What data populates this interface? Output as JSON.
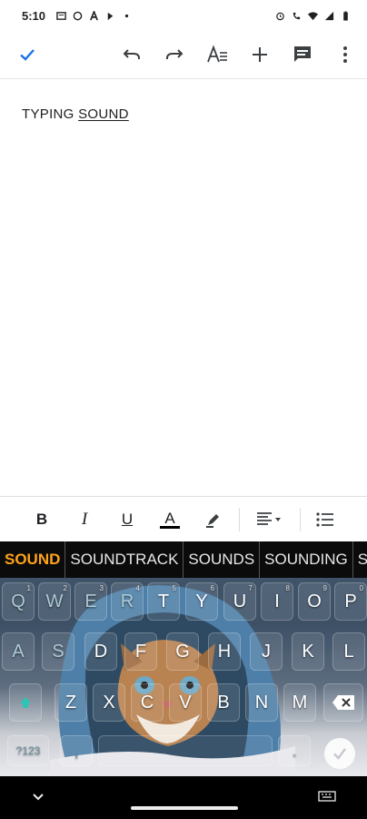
{
  "status_bar": {
    "time": "5:10",
    "left_icons": [
      "message-icon",
      "whatsapp-icon",
      "a-app-icon",
      "pen-app-icon",
      "dot-icon"
    ],
    "right_icons": [
      "alarm-icon",
      "wifi-calling-icon",
      "wifi-icon",
      "signal-icon",
      "battery-icon"
    ]
  },
  "toolbar": {
    "icons": [
      "checkmark-icon",
      "undo-icon",
      "redo-icon",
      "text-format-icon",
      "add-icon",
      "comment-icon",
      "more-vert-icon"
    ],
    "accent_color": "#1a73e8"
  },
  "document": {
    "text_plain": "TYPING ",
    "text_underlined": "SOUND"
  },
  "format_bar": {
    "bold": "B",
    "italic": "I",
    "underline": "U",
    "text_color": "A",
    "icons": [
      "bold-icon",
      "italic-icon",
      "underline-icon",
      "text-color-icon",
      "highlight-icon",
      "align-icon",
      "list-icon"
    ]
  },
  "keyboard": {
    "suggestions": [
      "SOUND",
      "SOUNDTRACK",
      "SOUNDS",
      "SOUNDING",
      "SO"
    ],
    "suggestion_highlight_color": "#ffa21a",
    "row1": [
      {
        "k": "Q",
        "n": "1"
      },
      {
        "k": "W",
        "n": "2"
      },
      {
        "k": "E",
        "n": "3"
      },
      {
        "k": "R",
        "n": "4"
      },
      {
        "k": "T",
        "n": "5"
      },
      {
        "k": "Y",
        "n": "6"
      },
      {
        "k": "U",
        "n": "7"
      },
      {
        "k": "I",
        "n": "8"
      },
      {
        "k": "O",
        "n": "9"
      },
      {
        "k": "P",
        "n": "0"
      }
    ],
    "row2": [
      "A",
      "S",
      "D",
      "F",
      "G",
      "H",
      "J",
      "K",
      "L"
    ],
    "row3": [
      "Z",
      "X",
      "C",
      "V",
      "B",
      "N",
      "M"
    ],
    "symbols_key": "?123",
    "comma_key": ",",
    "period_key": "."
  }
}
